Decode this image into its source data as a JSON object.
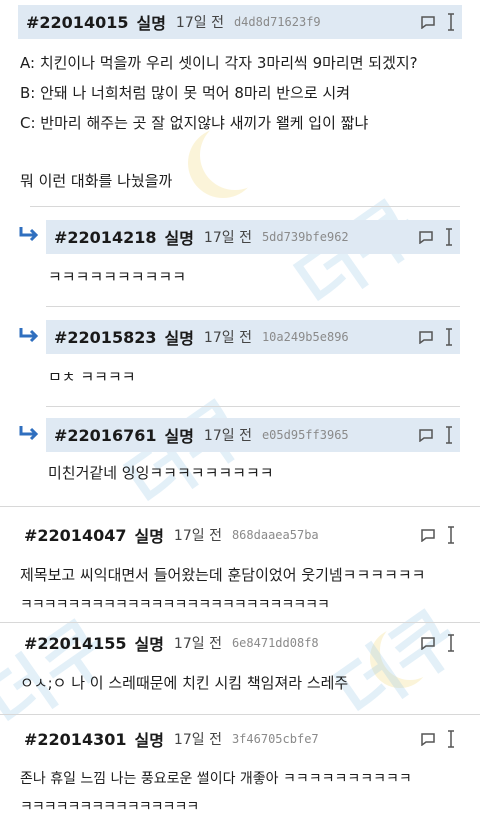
{
  "colors": {
    "header_bg": "#dfe9f3",
    "accent": "#2f6fbf",
    "watermark": "#9ecae8"
  },
  "comments": [
    {
      "id": "#22014015",
      "author": "실명",
      "time": "17일 전",
      "hash": "d4d8d71623f9",
      "lines": [
        "A: 치킨이나 먹을까 우리 셋이니 각자 3마리씩 9마리면 되겠지?",
        "B: 안돼 나 너희처럼 많이 못 먹어 8마리 반으로 시켜",
        "C: 반마리 해주는 곳 잘 없지않냐 새끼가 왤케 입이 짧냐",
        "",
        "뭐 이런 대화를 나눴을까"
      ]
    },
    {
      "id": "#22014218",
      "author": "실명",
      "time": "17일 전",
      "hash": "5dd739bfe962",
      "lines": [
        "ㅋㅋㅋㅋㅋㅋㅋㅋㅋㅋ"
      ]
    },
    {
      "id": "#22015823",
      "author": "실명",
      "time": "17일 전",
      "hash": "10a249b5e896",
      "lines": [
        "ㅁㅊ ㅋㅋㅋㅋ"
      ]
    },
    {
      "id": "#22016761",
      "author": "실명",
      "time": "17일 전",
      "hash": "e05d95ff3965",
      "lines": [
        "미친거같네 잉잉ㅋㅋㅋㅋㅋㅋㅋㅋㅋ"
      ]
    },
    {
      "id": "#22014047",
      "author": "실명",
      "time": "17일 전",
      "hash": "868daaea57ba",
      "lines": [
        "제목보고 씨익대면서 들어왔는데 훈담이었어 웃기넴ㅋㅋㅋㅋㅋㅋ",
        "ㅋㅋㅋㅋㅋㅋㅋㅋㅋㅋㅋㅋㅋㅋㅋㅋㅋㅋㅋㅋㅋㅋㅋㅋㅋㅋ"
      ]
    },
    {
      "id": "#22014155",
      "author": "실명",
      "time": "17일 전",
      "hash": "6e8471dd08f8",
      "lines": [
        "ㅇㅅ;ㅇ 나 이 스레때문에 치킨 시킴 책임져라 스레주"
      ]
    },
    {
      "id": "#22014301",
      "author": "실명",
      "time": "17일 전",
      "hash": "3f46705cbfe7",
      "lines": [
        "존나 휴일 느낌 나는 풍요로운 썰이다 개좋아 ㅋㅋㅋㅋㅋㅋㅋㅋㅋㅋ",
        "ㅋㅋㅋㅋㅋㅋㅋㅋㅋㅋㅋㅋㅋㅋㅋ"
      ]
    }
  ],
  "watermark": {
    "text": "더쿠"
  }
}
